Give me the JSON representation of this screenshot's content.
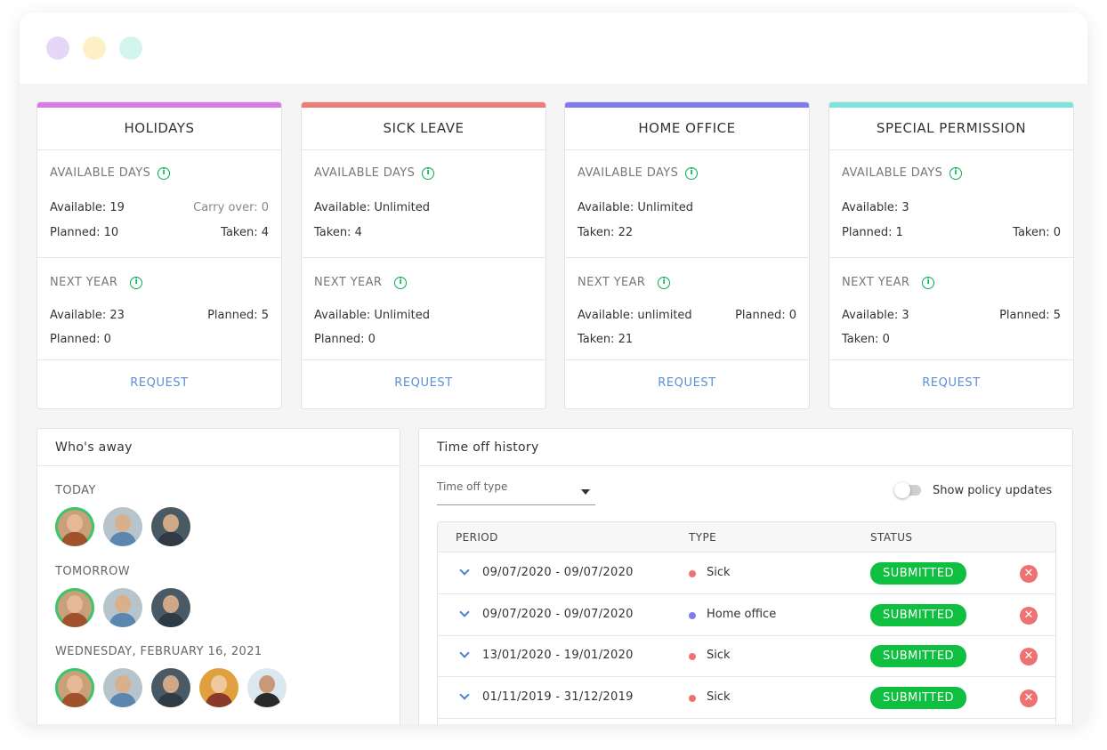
{
  "window": {
    "controls": [
      {
        "name": "close-dot",
        "color": "#e6d6f7"
      },
      {
        "name": "minimize-dot",
        "color": "#fdf0c8"
      },
      {
        "name": "maximize-dot",
        "color": "#d2f6ee"
      }
    ]
  },
  "cards": [
    {
      "title": "HOLIDAYS",
      "accent": "#d97ae8",
      "available_heading": "AVAILABLE DAYS",
      "available_rows": [
        {
          "left": "Available: 19",
          "right": "Carry over: 0"
        },
        {
          "left": "Planned: 10",
          "right": "Taken: 4"
        }
      ],
      "next_heading": "NEXT YEAR",
      "next_rows": [
        {
          "left": "Available: 23",
          "right": "Planned: 5"
        },
        {
          "left": "Planned: 0",
          "right": ""
        }
      ],
      "request_label": "REQUEST"
    },
    {
      "title": "SICK LEAVE",
      "accent": "#ef7b78",
      "available_heading": "AVAILABLE DAYS",
      "available_rows": [
        {
          "left": "Available: Unlimited",
          "right": ""
        },
        {
          "left": "Taken: 4",
          "right": ""
        }
      ],
      "next_heading": "NEXT YEAR",
      "next_rows": [
        {
          "left": "Available: Unlimited",
          "right": ""
        },
        {
          "left": "Planned: 0",
          "right": ""
        }
      ],
      "request_label": "REQUEST"
    },
    {
      "title": "HOME OFFICE",
      "accent": "#7f7bef",
      "available_heading": "AVAILABLE DAYS",
      "available_rows": [
        {
          "left": "Available: Unlimited",
          "right": ""
        },
        {
          "left": "Taken: 22",
          "right": ""
        }
      ],
      "next_heading": "NEXT YEAR",
      "next_rows": [
        {
          "left": "Available: unlimited",
          "right": "Planned: 0"
        },
        {
          "left": "Taken: 21",
          "right": ""
        }
      ],
      "request_label": "REQUEST"
    },
    {
      "title": "SPECIAL PERMISSION",
      "accent": "#7ee3dd",
      "available_heading": "AVAILABLE DAYS",
      "available_rows": [
        {
          "left": "Available: 3",
          "right": ""
        },
        {
          "left": "Planned: 1",
          "right": "Taken: 0"
        }
      ],
      "next_heading": "NEXT YEAR",
      "next_rows": [
        {
          "left": "Available: 3",
          "right": "Planned: 5"
        },
        {
          "left": "Taken: 0",
          "right": ""
        }
      ],
      "request_label": "REQUEST"
    }
  ],
  "whos_away": {
    "title": "Who's away",
    "groups": [
      {
        "label": "TODAY",
        "count": 3
      },
      {
        "label": "TOMORROW",
        "count": 3
      },
      {
        "label": "WEDNESDAY, FEBRUARY 16, 2021",
        "count": 5
      }
    ]
  },
  "history": {
    "title": "Time off history",
    "filter_placeholder": "Time off type",
    "toggle_label": "Show policy updates",
    "toggle_on": false,
    "columns": [
      "PERIOD",
      "TYPE",
      "STATUS"
    ],
    "rows": [
      {
        "period": "09/07/2020 - 09/07/2020",
        "type": "Sick",
        "type_color": "#ef7272",
        "status": "SUBMITTED"
      },
      {
        "period": "09/07/2020 - 09/07/2020",
        "type": "Home office",
        "type_color": "#7f7bef",
        "status": "SUBMITTED"
      },
      {
        "period": "13/01/2020 - 19/01/2020",
        "type": "Sick",
        "type_color": "#ef7272",
        "status": "SUBMITTED"
      },
      {
        "period": "01/11/2019 - 31/12/2019",
        "type": "Sick",
        "type_color": "#ef7272",
        "status": "SUBMITTED"
      }
    ],
    "status_color": "#0fbf3f"
  }
}
